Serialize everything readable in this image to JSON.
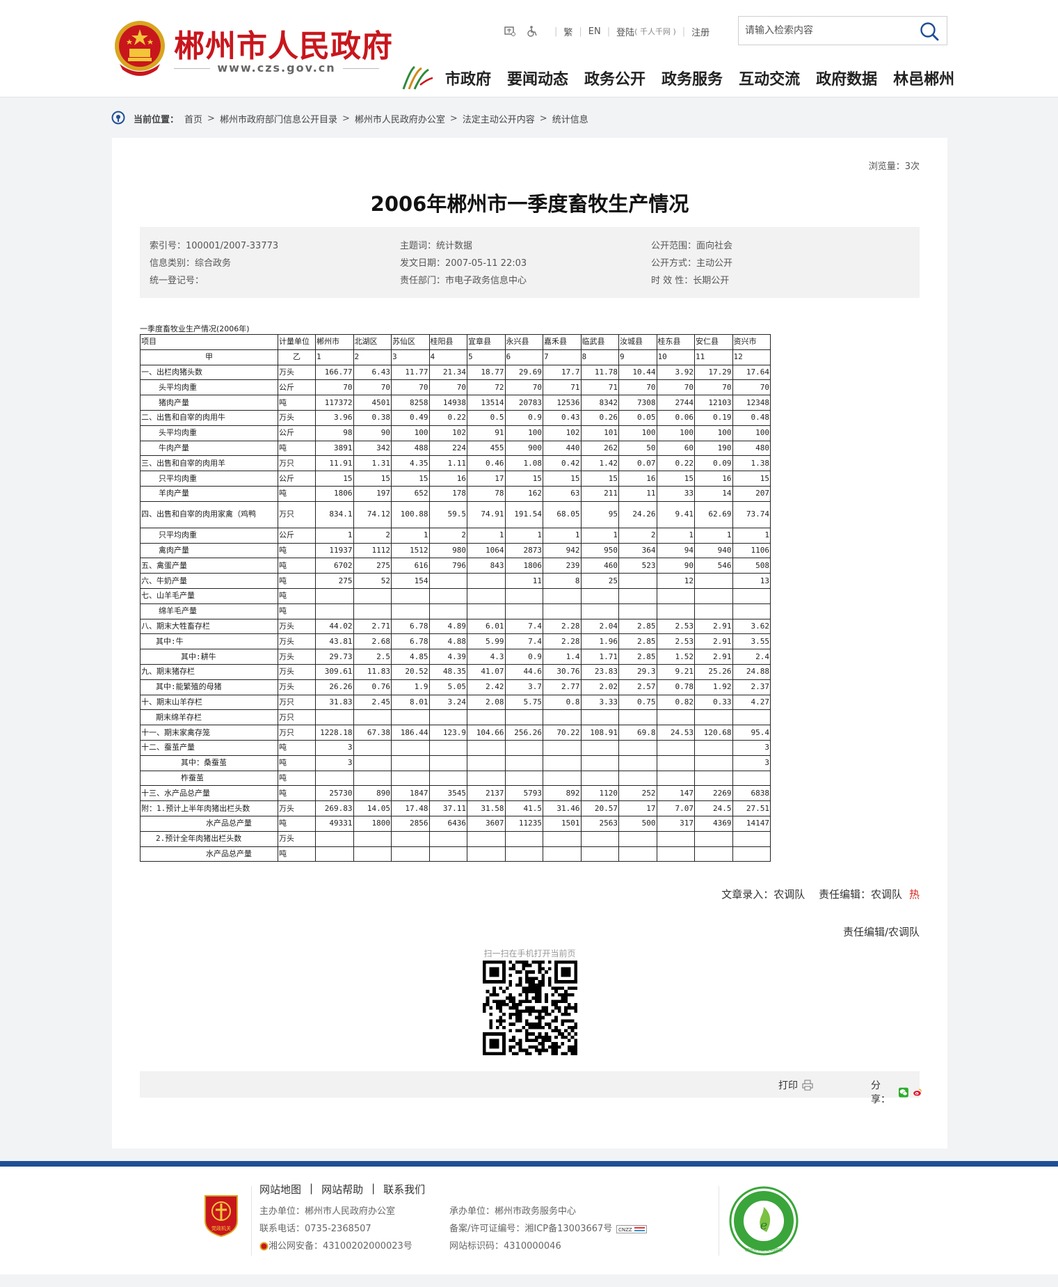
{
  "header": {
    "site_title": "郴州市人民政府",
    "site_url": "www.czs.gov.cn",
    "toplinks": {
      "traditional": "繁",
      "english": "EN",
      "login": "登陆",
      "login_note": "( 千人千网 )",
      "register": "注册"
    },
    "search_placeholder": "请输入检索内容",
    "nav": [
      "市政府",
      "要闻动态",
      "政务公开",
      "政务服务",
      "互动交流",
      "政府数据",
      "林邑郴州"
    ]
  },
  "breadcrumb": {
    "label": "当前位置：",
    "items": [
      "首页",
      "郴州市政府部门信息公开目录",
      "郴州市人民政府办公室",
      "法定主动公开内容",
      "统计信息"
    ]
  },
  "article": {
    "views": "浏览量：3次",
    "title": "2006年郴州市一季度畜牧生产情况",
    "meta": {
      "index_no": "索引号：100001/2007-33773",
      "category": "信息类别：综合政务",
      "reg_no": "统一登记号：",
      "topic": "主题词：统计数据",
      "date": "发文日期：2007-05-11 22:03",
      "dept": "责任部门：市电子政务信息中心",
      "scope": "公开范围：面向社会",
      "method": "公开方式：主动公开",
      "validity": "时 效 性：长期公开"
    },
    "table_caption": "一季度畜牧业生产情况(2006年)",
    "table": {
      "headers": [
        "项目",
        "计量单位",
        "郴州市",
        "北湖区",
        "苏仙区",
        "桂阳县",
        "宜章县",
        "永兴县",
        "嘉禾县",
        "临武县",
        "汝城县",
        "桂东县",
        "安仁县",
        "资兴市"
      ],
      "colnums": [
        "甲",
        "乙",
        "1",
        "2",
        "3",
        "4",
        "5",
        "6",
        "7",
        "8",
        "9",
        "10",
        "11",
        "12"
      ],
      "rows": [
        {
          "item": "一、出栏肉猪头数",
          "ind": "",
          "unit": "万头",
          "v": [
            "166.77",
            "6.43",
            "11.77",
            "21.34",
            "18.77",
            "29.69",
            "17.7",
            "11.78",
            "10.44",
            "3.92",
            "17.29",
            "17.64"
          ]
        },
        {
          "item": "头平均肉重",
          "ind": "ind1",
          "unit": "公斤",
          "v": [
            "70",
            "70",
            "70",
            "70",
            "72",
            "70",
            "71",
            "71",
            "70",
            "70",
            "70",
            "70"
          ]
        },
        {
          "item": "猪肉产量",
          "ind": "ind1",
          "unit": "吨",
          "v": [
            "117372",
            "4501",
            "8258",
            "14938",
            "13514",
            "20783",
            "12536",
            "8342",
            "7308",
            "2744",
            "12103",
            "12348"
          ]
        },
        {
          "item": "二、出售和自宰的肉用牛",
          "ind": "",
          "unit": "万头",
          "v": [
            "3.96",
            "0.38",
            "0.49",
            "0.22",
            "0.5",
            "0.9",
            "0.43",
            "0.26",
            "0.05",
            "0.06",
            "0.19",
            "0.48"
          ]
        },
        {
          "item": "头平均肉重",
          "ind": "ind1",
          "unit": "公斤",
          "v": [
            "98",
            "90",
            "100",
            "102",
            "91",
            "100",
            "102",
            "101",
            "100",
            "100",
            "100",
            "100"
          ]
        },
        {
          "item": "牛肉产量",
          "ind": "ind1",
          "unit": "吨",
          "v": [
            "3891",
            "342",
            "488",
            "224",
            "455",
            "900",
            "440",
            "262",
            "50",
            "60",
            "190",
            "480"
          ]
        },
        {
          "item": "三、出售和自宰的肉用羊",
          "ind": "",
          "unit": "万只",
          "v": [
            "11.91",
            "1.31",
            "4.35",
            "1.11",
            "0.46",
            "1.08",
            "0.42",
            "1.42",
            "0.07",
            "0.22",
            "0.09",
            "1.38"
          ]
        },
        {
          "item": "只平均肉重",
          "ind": "ind1",
          "unit": "公斤",
          "v": [
            "15",
            "15",
            "15",
            "16",
            "17",
            "15",
            "15",
            "15",
            "16",
            "15",
            "16",
            "15"
          ]
        },
        {
          "item": "羊肉产量",
          "ind": "ind1",
          "unit": "吨",
          "v": [
            "1806",
            "197",
            "652",
            "178",
            "78",
            "162",
            "63",
            "211",
            "11",
            "33",
            "14",
            "207"
          ]
        },
        {
          "item": "四、出售和自宰的肉用家禽（鸡鸭",
          "ind": "tall",
          "unit": "万只",
          "v": [
            "834.1",
            "74.12",
            "100.88",
            "59.5",
            "74.91",
            "191.54",
            "68.05",
            "95",
            "24.26",
            "9.41",
            "62.69",
            "73.74"
          ]
        },
        {
          "item": "只平均肉重",
          "ind": "ind1",
          "unit": "公斤",
          "v": [
            "1",
            "2",
            "1",
            "2",
            "1",
            "1",
            "1",
            "1",
            "2",
            "1",
            "1",
            "1"
          ]
        },
        {
          "item": "禽肉产量",
          "ind": "ind1",
          "unit": "吨",
          "v": [
            "11937",
            "1112",
            "1512",
            "980",
            "1064",
            "2873",
            "942",
            "950",
            "364",
            "94",
            "940",
            "1106"
          ]
        },
        {
          "item": "五、禽蛋产量",
          "ind": "",
          "unit": "吨",
          "v": [
            "6702",
            "275",
            "616",
            "796",
            "843",
            "1806",
            "239",
            "460",
            "523",
            "90",
            "546",
            "508"
          ]
        },
        {
          "item": "六、牛奶产量",
          "ind": "",
          "unit": "吨",
          "v": [
            "275",
            "52",
            "154",
            "",
            "",
            "11",
            "8",
            "25",
            "",
            "12",
            "",
            "13"
          ]
        },
        {
          "item": "七、山羊毛产量",
          "ind": "",
          "unit": "吨",
          "v": [
            "",
            "",
            "",
            "",
            "",
            "",
            "",
            "",
            "",
            "",
            "",
            ""
          ]
        },
        {
          "item": "绵羊毛产量",
          "ind": "ind1",
          "unit": "吨",
          "v": [
            "",
            "",
            "",
            "",
            "",
            "",
            "",
            "",
            "",
            "",
            "",
            ""
          ]
        },
        {
          "item": "八、期末大牲畜存栏",
          "ind": "",
          "unit": "万头",
          "v": [
            "44.02",
            "2.71",
            "6.78",
            "4.89",
            "6.01",
            "7.4",
            "2.28",
            "2.04",
            "2.85",
            "2.53",
            "2.91",
            "3.62"
          ]
        },
        {
          "item": "其中:牛",
          "ind": "ind5",
          "unit": "万头",
          "v": [
            "43.81",
            "2.68",
            "6.78",
            "4.88",
            "5.99",
            "7.4",
            "2.28",
            "1.96",
            "2.85",
            "2.53",
            "2.91",
            "3.55"
          ]
        },
        {
          "item": "其中:耕牛",
          "ind": "ind3",
          "unit": "万头",
          "v": [
            "29.73",
            "2.5",
            "4.85",
            "4.39",
            "4.3",
            "0.9",
            "1.4",
            "1.71",
            "2.85",
            "1.52",
            "2.91",
            "2.4"
          ]
        },
        {
          "item": "九、期末猪存栏",
          "ind": "",
          "unit": "万头",
          "v": [
            "309.61",
            "11.83",
            "20.52",
            "48.35",
            "41.07",
            "44.6",
            "30.76",
            "23.83",
            "29.3",
            "9.21",
            "25.26",
            "24.88"
          ]
        },
        {
          "item": "其中:能繁殖的母猪",
          "ind": "ind5",
          "unit": "万头",
          "v": [
            "26.26",
            "0.76",
            "1.9",
            "5.05",
            "2.42",
            "3.7",
            "2.77",
            "2.02",
            "2.57",
            "0.78",
            "1.92",
            "2.37"
          ]
        },
        {
          "item": "十、期末山羊存栏",
          "ind": "",
          "unit": "万只",
          "v": [
            "31.83",
            "2.45",
            "8.01",
            "3.24",
            "2.08",
            "5.75",
            "0.8",
            "3.33",
            "0.75",
            "0.82",
            "0.33",
            "4.27"
          ]
        },
        {
          "item": "期末绵羊存栏",
          "ind": "ind5",
          "unit": "万只",
          "v": [
            "",
            "",
            "",
            "",
            "",
            "",
            "",
            "",
            "",
            "",
            "",
            ""
          ]
        },
        {
          "item": "十一、期末家禽存笼",
          "ind": "",
          "unit": "万只",
          "v": [
            "1228.18",
            "67.38",
            "186.44",
            "123.9",
            "104.66",
            "256.26",
            "70.22",
            "108.91",
            "69.8",
            "24.53",
            "120.68",
            "95.4"
          ]
        },
        {
          "item": "十二、蚕茧产量",
          "ind": "",
          "unit": "吨",
          "v": [
            "3",
            "",
            "",
            "",
            "",
            "",
            "",
            "",
            "",
            "",
            "",
            "3"
          ]
        },
        {
          "item": "其中：桑蚕茧",
          "ind": "ind3",
          "unit": "吨",
          "v": [
            "3",
            "",
            "",
            "",
            "",
            "",
            "",
            "",
            "",
            "",
            "",
            "3"
          ]
        },
        {
          "item": "柞蚕茧",
          "ind": "ind3",
          "unit": "吨",
          "v": [
            "",
            "",
            "",
            "",
            "",
            "",
            "",
            "",
            "",
            "",
            "",
            ""
          ]
        },
        {
          "item": "十三、水产品总产量",
          "ind": "",
          "unit": "吨",
          "v": [
            "25730",
            "890",
            "1847",
            "3545",
            "2137",
            "5793",
            "892",
            "1120",
            "252",
            "147",
            "2269",
            "6838"
          ]
        },
        {
          "item": "附：1.预计上半年肉猪出栏头数",
          "ind": "",
          "unit": "万头",
          "v": [
            "269.83",
            "14.05",
            "17.48",
            "37.11",
            "31.58",
            "41.5",
            "31.46",
            "20.57",
            "17",
            "7.07",
            "24.5",
            "27.51"
          ]
        },
        {
          "item": "水产品总产量",
          "ind": "ind4",
          "unit": "吨",
          "v": [
            "49331",
            "1800",
            "2856",
            "6436",
            "3607",
            "11235",
            "1501",
            "2563",
            "500",
            "317",
            "4369",
            "14147"
          ]
        },
        {
          "item": "2.预计全年肉猪出栏头数",
          "ind": "ind5",
          "unit": "万头",
          "v": [
            "",
            "",
            "",
            "",
            "",
            "",
            "",
            "",
            "",
            "",
            "",
            ""
          ]
        },
        {
          "item": "水产品总产量",
          "ind": "ind4",
          "unit": "吨",
          "v": [
            "",
            "",
            "",
            "",
            "",
            "",
            "",
            "",
            "",
            "",
            "",
            ""
          ]
        }
      ]
    },
    "editors": "文章录入：农调队　 责任编辑：农调队",
    "hot": "热",
    "resp_editor": "责任编辑/农调队",
    "qr_label": "扫一扫在手机打开当前页",
    "print": "打印",
    "share": "分享："
  },
  "footer": {
    "links": [
      "网站地图",
      "网站帮助",
      "联系我们"
    ],
    "host": "主办单位：郴州市人民政府办公室",
    "phone": "联系电话：0735-2368507",
    "police": "湘公网安备：43100202000023号",
    "undertake": "承办单位：郴州市政务服务中心",
    "icp": "备案/许可证编号：湘ICP备13003667号",
    "site_code": "网站标识码：4310000046",
    "badge_text": "党政机关",
    "logo_text": "郴州市创建文明网站"
  },
  "colors": {
    "brand_red": "#c8161d",
    "footer_blue": "#1e4e95",
    "hot_red": "#d9251c"
  }
}
